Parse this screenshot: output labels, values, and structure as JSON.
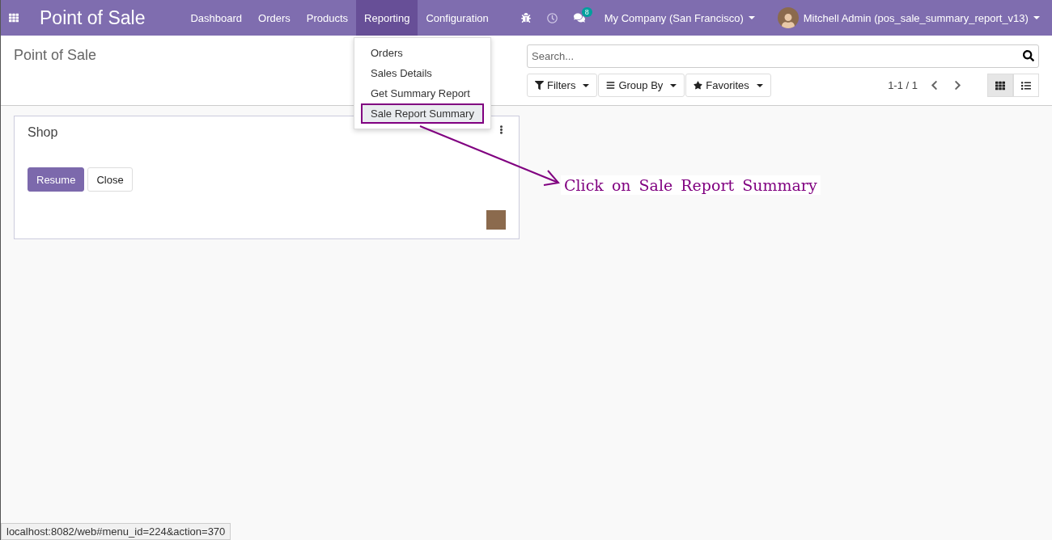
{
  "navbar": {
    "app_title": "Point of Sale",
    "menus": [
      {
        "label": "Dashboard",
        "selected": false
      },
      {
        "label": "Orders",
        "selected": false
      },
      {
        "label": "Products",
        "selected": false
      },
      {
        "label": "Reporting",
        "selected": true
      },
      {
        "label": "Configuration",
        "selected": false
      }
    ],
    "message_count": "8",
    "company": "My Company (San Francisco)",
    "user": "Mitchell Admin (pos_sale_summary_report_v13)"
  },
  "dropdown": {
    "items": [
      {
        "label": "Orders",
        "selected": false
      },
      {
        "label": "Sales Details",
        "selected": false
      },
      {
        "label": "Get Summary Report",
        "selected": false
      },
      {
        "label": "Sale Report Summary",
        "selected": true
      }
    ]
  },
  "control_panel": {
    "breadcrumb": "Point of Sale",
    "search": {
      "placeholder": "Search..."
    },
    "filters": [
      {
        "kind": "filter",
        "label": "Filters"
      },
      {
        "kind": "group",
        "label": "Group By"
      },
      {
        "kind": "favorite",
        "label": "Favorites"
      }
    ],
    "pager": "1-1 / 1",
    "views": [
      {
        "kind": "kanban",
        "selected": true
      },
      {
        "kind": "list",
        "selected": false
      }
    ]
  },
  "cards": [
    {
      "title": "Shop",
      "buttons": [
        {
          "label": "Resume",
          "primary": true
        },
        {
          "label": "Close",
          "primary": false
        }
      ]
    }
  ],
  "annotation": "Click on Sale Report Summary",
  "status_bar": "localhost:8082/web#menu_id=224&action=370"
}
